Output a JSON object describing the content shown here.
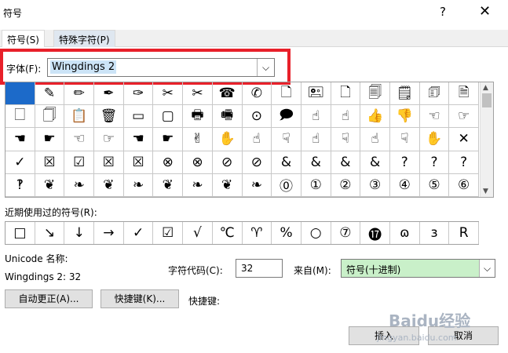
{
  "window": {
    "title": "符号",
    "help": "?",
    "close": "✕"
  },
  "tabs": [
    {
      "label": "符号(S)"
    },
    {
      "label": "特殊字符(P)"
    }
  ],
  "font": {
    "label": "字体(F):",
    "value": "Wingdings 2"
  },
  "grid": {
    "rows": [
      [
        "",
        "✎",
        "✏",
        "✒",
        "✑",
        "✂",
        "✂",
        "☎",
        "✆",
        "🗋",
        "🖭",
        "🗋",
        "🗐",
        "🗒",
        "🗊",
        "🗎"
      ],
      [
        "🗌",
        "🗍",
        "📋",
        "🗑",
        "▭",
        "▢",
        "🖶",
        "🖷",
        "⊙",
        "🗩",
        "☝",
        "☝",
        "👍",
        "👎",
        "☜",
        "☞"
      ],
      [
        "☚",
        "☛",
        "☜",
        "☞",
        "☚",
        "☛",
        "✌",
        "✋",
        "☝",
        "☟",
        "☝",
        "☟",
        "☝",
        "☟",
        "✋",
        "✕"
      ],
      [
        "✓",
        "☒",
        "☑",
        "☒",
        "☒",
        "⊗",
        "⊗",
        "⊘",
        "⊘",
        "&",
        "&",
        "&",
        "&",
        "?",
        "?",
        "?"
      ],
      [
        "‽",
        "❦",
        "❧",
        "❦",
        "❧",
        "❦",
        "❧",
        "❦",
        "❧",
        "⓪",
        "①",
        "②",
        "③",
        "④",
        "⑤",
        "⑥"
      ]
    ]
  },
  "recent": {
    "label": "近期使用过的符号(R):",
    "symbols": [
      "□",
      "↘",
      "↓",
      "→",
      "✓",
      "☑",
      "√",
      "℃",
      "♈",
      "%",
      "○",
      "⑦",
      "⓱",
      "ɷ",
      "ɜ",
      "R"
    ]
  },
  "unicode": {
    "label": "Unicode 名称:",
    "value": "Wingdings 2: 32"
  },
  "char_code": {
    "label": "字符代码(C):",
    "value": "32"
  },
  "from": {
    "label": "来自(M):",
    "value": "符号(十进制)"
  },
  "buttons": {
    "autocorrect": "自动更正(A)...",
    "shortcut": "快捷键(K)...",
    "shortcut_label": "快捷键:",
    "insert": "插入",
    "cancel": "取消"
  },
  "watermark": {
    "text": "Baidu经验",
    "sub": "jingyan.baidu.com"
  }
}
